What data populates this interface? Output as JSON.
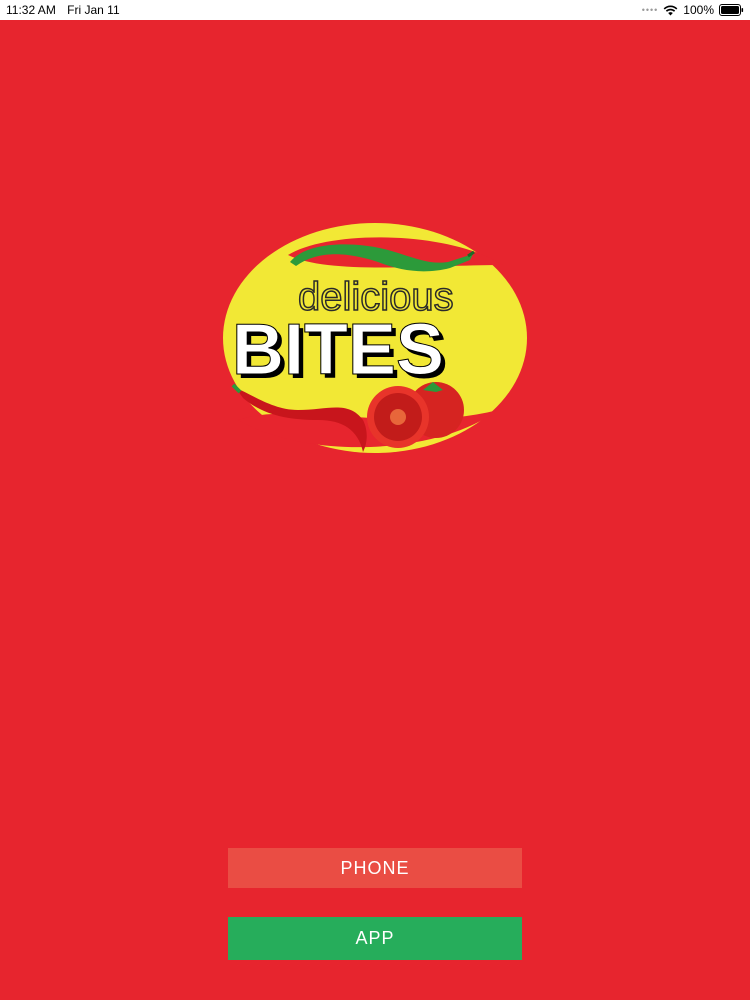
{
  "status_bar": {
    "time": "11:32 AM",
    "date": "Fri Jan 11",
    "signal_icon": "signal-dots",
    "wifi_icon": "wifi-icon",
    "battery": "100%",
    "battery_icon": "battery-icon"
  },
  "logo": {
    "line1": "delicious",
    "line2": "BITES"
  },
  "buttons": {
    "phone_label": "PHONE",
    "app_label": "APP"
  },
  "colors": {
    "background": "#e7252e",
    "phone_button": "#ea4d44",
    "app_button": "#26ad5b",
    "logo_yellow": "#f2e835"
  }
}
